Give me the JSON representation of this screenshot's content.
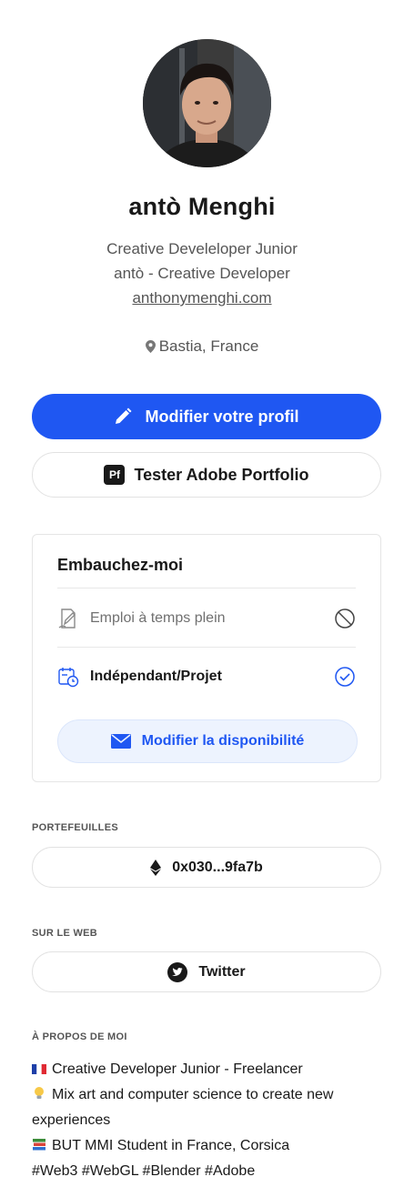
{
  "profile": {
    "name": "antò Menghi",
    "headline": "Creative Develeloper Junior",
    "company": "antò - Creative Developer",
    "website": "anthonymenghi.com",
    "location": "Bastia, France"
  },
  "actions": {
    "edit_profile": "Modifier votre profil",
    "adobe_portfolio_badge": "Pf",
    "adobe_portfolio": "Tester Adobe Portfolio"
  },
  "hire": {
    "title": "Embauchez-moi",
    "options": [
      {
        "label": "Emploi à temps plein",
        "status": "unavailable"
      },
      {
        "label": "Indépendant/Projet",
        "status": "available"
      }
    ],
    "edit_availability": "Modifier la disponibilité"
  },
  "wallets": {
    "label": "PORTEFEUILLES",
    "address": "0x030...9fa7b"
  },
  "web": {
    "label": "SUR LE WEB",
    "twitter": "Twitter"
  },
  "about": {
    "label": "À PROPOS DE MOI",
    "lines": [
      "Creative Developer Junior -  Freelancer",
      "Mix art and computer science to create new experiences",
      "BUT MMI Student in France, Corsica",
      "#Web3 #WebGL #Blender #Adobe"
    ]
  },
  "colors": {
    "accent": "#1f57f2",
    "accent_soft": "#edf3fe",
    "text": "#191919",
    "muted": "#707070"
  },
  "icons": [
    "location-pin-icon",
    "pencil-icon",
    "adobe-portfolio-icon",
    "signature-icon",
    "block-icon",
    "calendar-clock-icon",
    "check-circle-icon",
    "envelope-icon",
    "ethereum-icon",
    "twitter-icon"
  ]
}
